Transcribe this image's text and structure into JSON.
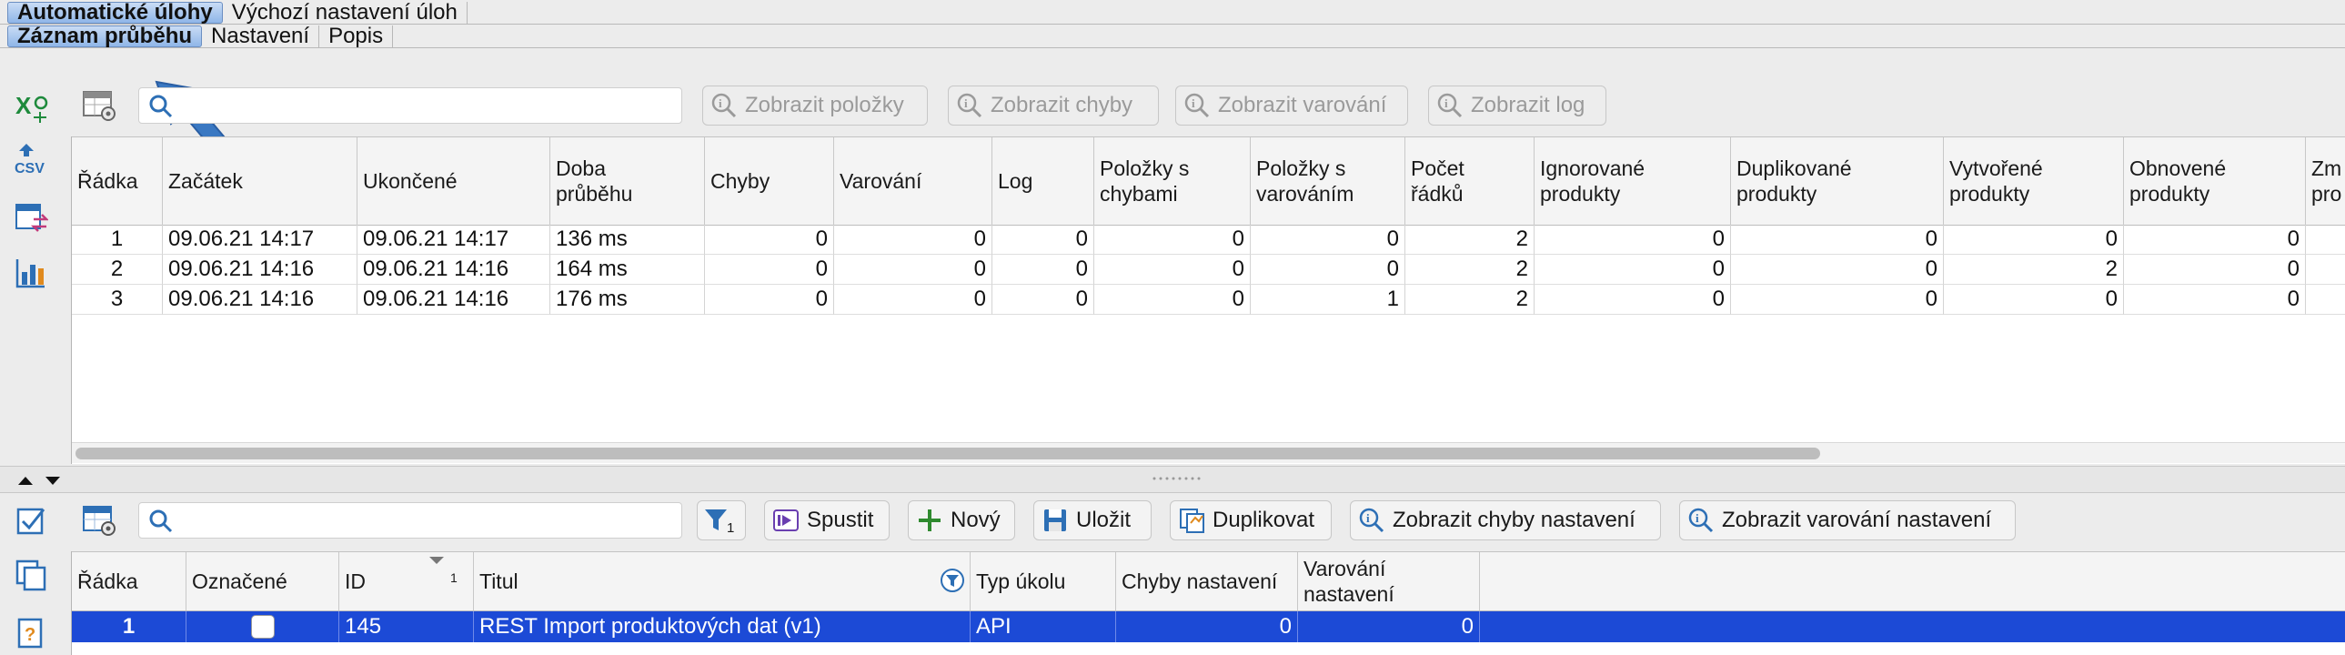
{
  "top_tabs": [
    {
      "label": "Automatické úlohy",
      "active": true
    },
    {
      "label": "Výchozí nastavení úloh",
      "active": false
    }
  ],
  "sub_tabs": [
    {
      "label": "Záznam průběhu",
      "active": true
    },
    {
      "label": "Nastavení",
      "active": false
    },
    {
      "label": "Popis",
      "active": false
    }
  ],
  "upper_toolbar": {
    "search_placeholder": "",
    "buttons": [
      {
        "label": "Zobrazit položky",
        "icon": "info-magnifier-icon",
        "enabled": false
      },
      {
        "label": "Zobrazit chyby",
        "icon": "info-magnifier-icon",
        "enabled": false
      },
      {
        "label": "Zobrazit varování",
        "icon": "info-magnifier-icon",
        "enabled": false
      },
      {
        "label": "Zobrazit log",
        "icon": "info-magnifier-icon",
        "enabled": false
      }
    ]
  },
  "log_table": {
    "columns": [
      {
        "label": "Řádka"
      },
      {
        "label": "Začátek"
      },
      {
        "label": "Ukončené"
      },
      {
        "label": "Doba\nprůběhu"
      },
      {
        "label": "Chyby"
      },
      {
        "label": "Varování"
      },
      {
        "label": "Log"
      },
      {
        "label": "Položky s\nchybami"
      },
      {
        "label": "Položky s\nvarováním"
      },
      {
        "label": "Počet\nřádků"
      },
      {
        "label": "Ignorované\nprodukty"
      },
      {
        "label": "Duplikované\nprodukty"
      },
      {
        "label": "Vytvořené\nprodukty"
      },
      {
        "label": "Obnovené\nprodukty"
      },
      {
        "label": "Zm\npro"
      }
    ],
    "rows": [
      [
        "1",
        "09.06.21 14:17",
        "09.06.21 14:17",
        "136 ms",
        "0",
        "0",
        "0",
        "0",
        "0",
        "2",
        "0",
        "0",
        "0",
        "0",
        ""
      ],
      [
        "2",
        "09.06.21 14:16",
        "09.06.21 14:16",
        "164 ms",
        "0",
        "0",
        "0",
        "0",
        "0",
        "2",
        "0",
        "0",
        "2",
        "0",
        ""
      ],
      [
        "3",
        "09.06.21 14:16",
        "09.06.21 14:16",
        "176 ms",
        "0",
        "0",
        "0",
        "0",
        "1",
        "2",
        "0",
        "0",
        "0",
        "0",
        ""
      ]
    ]
  },
  "lower_toolbar": {
    "search_placeholder": "",
    "filter_count": "1",
    "buttons": [
      {
        "label": "Spustit",
        "icon": "run-icon"
      },
      {
        "label": "Nový",
        "icon": "plus-icon"
      },
      {
        "label": "Uložit",
        "icon": "save-icon"
      },
      {
        "label": "Duplikovat",
        "icon": "duplicate-icon"
      },
      {
        "label": "Zobrazit chyby nastavení",
        "icon": "info-magnifier-icon"
      },
      {
        "label": "Zobrazit varování nastavení",
        "icon": "info-magnifier-icon"
      }
    ]
  },
  "tasks_table": {
    "columns": [
      {
        "label": "Řádka"
      },
      {
        "label": "Označené"
      },
      {
        "label": "ID",
        "sort_index": "1"
      },
      {
        "label": "Titul"
      },
      {
        "label": "Typ úkolu"
      },
      {
        "label": "Chyby nastavení"
      },
      {
        "label": "Varování\nnastavení"
      }
    ],
    "rows": [
      {
        "row": "1",
        "checked": false,
        "id": "145",
        "title": "REST Import produktových dat (v1)",
        "type": "API",
        "errors": "0",
        "warnings": "0",
        "selected": true
      }
    ]
  },
  "colors": {
    "selection": "#1c4ad6",
    "active_tab": "#8fb6e8",
    "arrow": "#3a78c2"
  }
}
